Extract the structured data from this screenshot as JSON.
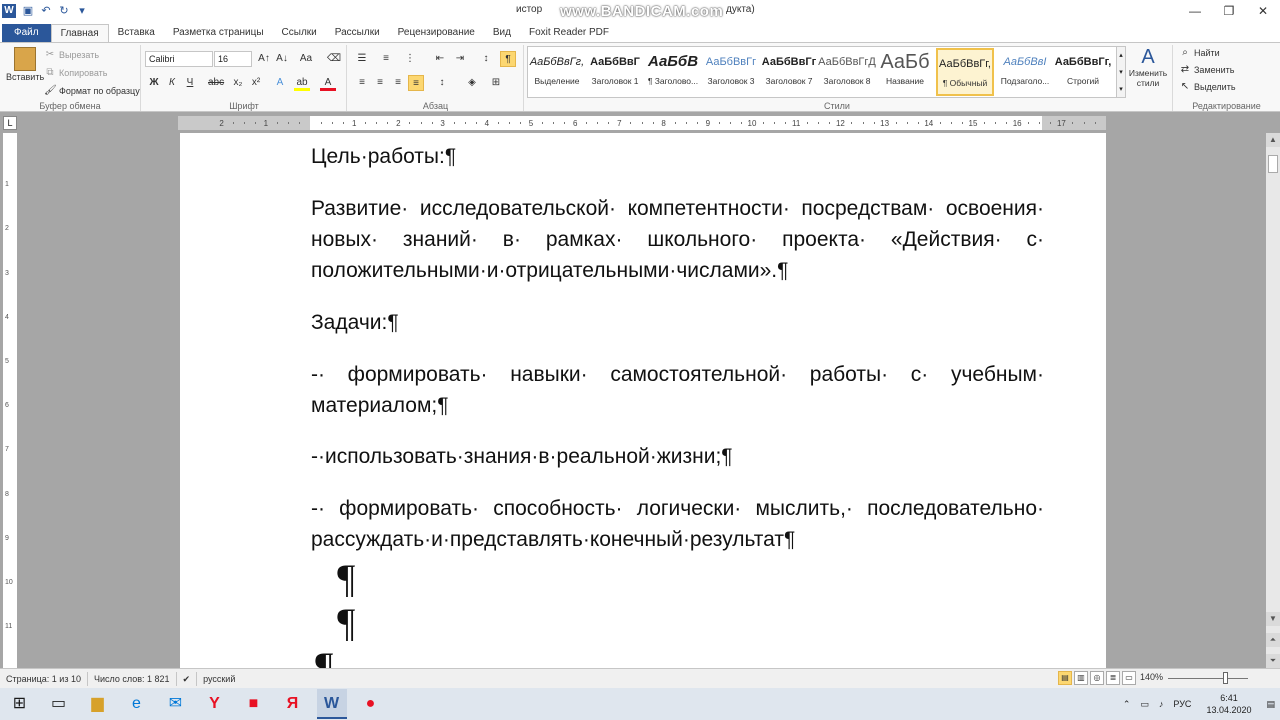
{
  "titlebar": {
    "title_left": "истор",
    "title_right": "дукта)",
    "watermark": "www.BANDICAM.com",
    "minimize": "—",
    "maximize": "❐",
    "close": "✕"
  },
  "tabs": [
    {
      "label": "Файл"
    },
    {
      "label": "Главная"
    },
    {
      "label": "Вставка"
    },
    {
      "label": "Разметка страницы"
    },
    {
      "label": "Ссылки"
    },
    {
      "label": "Рассылки"
    },
    {
      "label": "Рецензирование"
    },
    {
      "label": "Вид"
    },
    {
      "label": "Foxit Reader PDF"
    }
  ],
  "clipboard": {
    "paste": "Вставить",
    "cut": "Вырезать",
    "copy": "Копировать",
    "format_painter": "Формат по образцу",
    "label": "Буфер обмена"
  },
  "font": {
    "name": "Calibri",
    "size": "16",
    "label": "Шрифт"
  },
  "paragraph": {
    "label": "Абзац"
  },
  "styles": {
    "label": "Стили",
    "items": [
      {
        "sample": "АаБбВвГг,",
        "name": "Выделение"
      },
      {
        "sample": "АаБбВвГ",
        "name": "Заголовок 1"
      },
      {
        "sample": "АаБбВ",
        "name": "¶ Заголово..."
      },
      {
        "sample": "АаБбВвГг",
        "name": "Заголовок 3"
      },
      {
        "sample": "АаБбВвГг",
        "name": "Заголовок 7"
      },
      {
        "sample": "АаБбВвГгД",
        "name": "Заголовок 8"
      },
      {
        "sample": "АаБб",
        "name": "Название"
      },
      {
        "sample": "АаБбВвГг,",
        "name": "¶ Обычный"
      },
      {
        "sample": "АаБбВвI",
        "name": "Подзаголо..."
      },
      {
        "sample": "АаБбВвГг,",
        "name": "Строгий"
      }
    ],
    "change_styles": "Изменить стили"
  },
  "editing": {
    "find": "Найти",
    "replace": "Заменить",
    "select": "Выделить",
    "label": "Редактирование"
  },
  "document": {
    "heading_goal": "Цель·работы:¶",
    "goal_text": "Развитие· исследовательской· компетентности· посредствам· освоения· новых· знаний· в· рамках· школьного· проекта· «Действия· с· положительными·и·отрицательными·числами».¶",
    "heading_tasks": "Задачи:¶",
    "task1": "-· формировать· навыки· самостоятельной· работы· с· учебным· материалом;¶",
    "task2": "-·использовать·знания·в·реальной·жизни;¶",
    "task3": "-· формировать· способность· логически· мыслить,· последовательно· рассуждать·и·представлять·конечный·результат¶",
    "mark": "¶"
  },
  "statusbar": {
    "page": "Страница: 1 из 10",
    "words": "Число слов: 1 821",
    "lang": "русский",
    "zoom": "140%"
  },
  "taskbar": {
    "lang": "РУС",
    "time": "6:41",
    "date": "13.04.2020"
  },
  "colors": {
    "accent": "#2b579a",
    "selected_style": "#fdf3d1",
    "record": "#e81123"
  }
}
